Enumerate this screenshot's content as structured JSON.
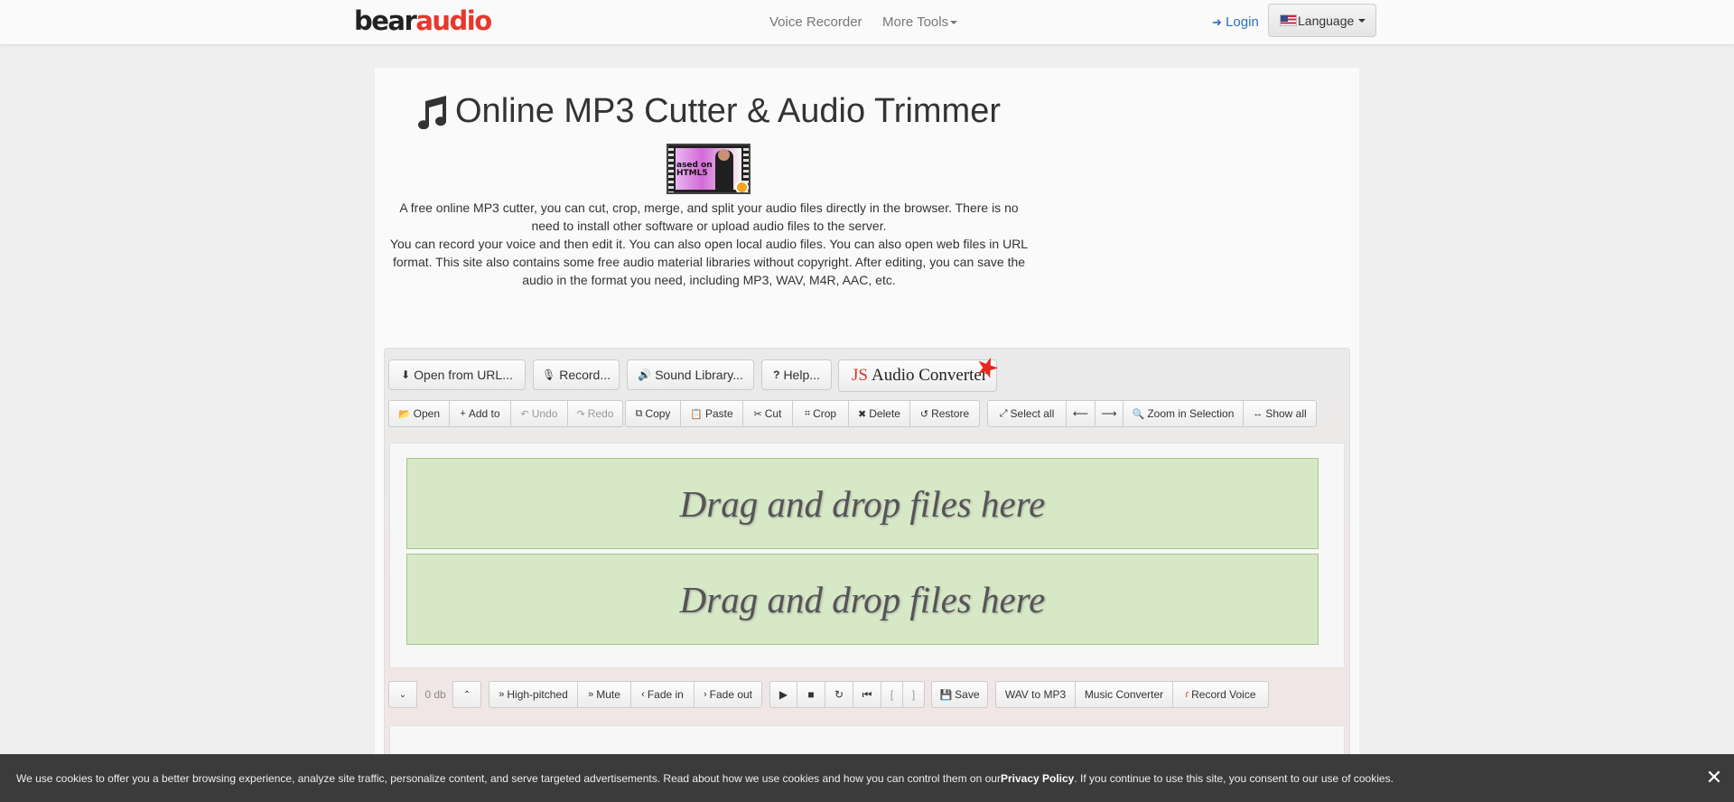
{
  "navbar": {
    "logo_bear": "bear",
    "logo_audio": "audio",
    "voice_recorder": "Voice Recorder",
    "more_tools": "More Tools",
    "login": "Login",
    "language": "Language"
  },
  "header": {
    "title": "Online MP3 Cutter & Audio Trimmer",
    "video_text_1": "ased on",
    "video_text_2": "HTML5",
    "desc_1": "A free online MP3 cutter, you can cut, crop, merge, and split your audio files directly in the browser. There is no need to install other software or upload audio files to the server.",
    "desc_2": "You can record your voice and then edit it. You can also open local audio files. You can also open web files in URL format. This site also contains some free audio material libraries without copyright. After editing, you can save the audio in the format you need, including MP3, WAV, M4R, AAC, etc."
  },
  "top_buttons": {
    "open_url": "Open from URL...",
    "record": "Record...",
    "sound_library": "Sound Library...",
    "help": "Help...",
    "js": "JS",
    "audio_converter": "Audio Converter"
  },
  "toolbar": {
    "open": "Open",
    "add_to": "Add to",
    "undo": "Undo",
    "redo": "Redo",
    "copy": "Copy",
    "paste": "Paste",
    "cut": "Cut",
    "crop": "Crop",
    "delete": "Delete",
    "restore": "Restore",
    "select_all": "Select all",
    "arrow_left": "⟵",
    "arrow_right": "⟶",
    "zoom_in_selection": "Zoom in Selection",
    "show_all": "Show all"
  },
  "dropzones": {
    "track1": "Drag and drop files here",
    "track2": "Drag and drop files here"
  },
  "bottom_toolbar": {
    "volume_db": "0 db",
    "high_pitched": "High-pitched",
    "mute": "Mute",
    "fade_in": "Fade in",
    "fade_out": "Fade out",
    "mark_start": "[",
    "mark_end": "]",
    "save": "Save",
    "wav_to_mp3": "WAV to MP3",
    "music_converter": "Music Converter",
    "record_voice": "Record Voice"
  },
  "cookie": {
    "text_before": "We use cookies to offer you a better browsing experience, analyze site traffic, personalize content, and serve targeted advertisements. Read about how we use cookies and how you can control them on our ",
    "policy_link": "Privacy Policy",
    "text_after": ". If you continue to use this site, you consent to our use of cookies.",
    "close": "✕"
  },
  "colors": {
    "brand_red": "#e8372b",
    "link_blue": "#2a6ec4",
    "dropzone_green": "#d6e8c5",
    "cookie_bar": "#3b3b3b"
  }
}
